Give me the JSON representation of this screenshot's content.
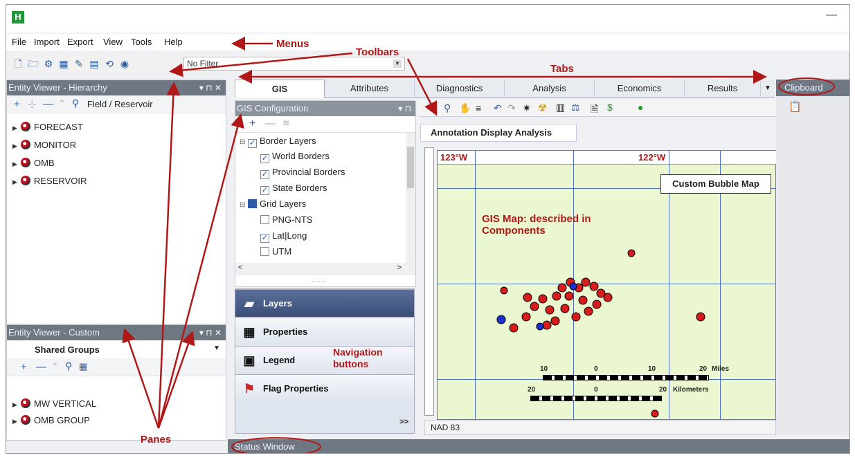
{
  "app": {
    "logo": "H",
    "minimize": "—"
  },
  "menus": [
    "File",
    "Import",
    "Export",
    "View",
    "Tools",
    "Help"
  ],
  "toolbar": {
    "filter_value": "No Filter"
  },
  "hierarchy": {
    "title": "Entity Viewer - Hierarchy",
    "pane_controls": "▾ ⊓ ✕",
    "toolbar_label": "Field / Reservoir",
    "items": [
      "FORECAST",
      "MONITOR",
      "OMB",
      "RESERVOIR"
    ]
  },
  "custom": {
    "title": "Entity Viewer - Custom",
    "pane_controls": "▾ ⊓ ✕",
    "dropdown": "Shared Groups",
    "items": [
      "MW VERTICAL",
      "OMB GROUP"
    ]
  },
  "tabs": [
    "GIS",
    "Attributes",
    "Diagnostics",
    "Analysis",
    "Economics",
    "Results"
  ],
  "gis_config": {
    "title": "GIS Configuration",
    "pane_controls": "▾ ⊓",
    "tree": [
      {
        "label": "Border Layers",
        "level": 0,
        "checked": true
      },
      {
        "label": "World Borders",
        "level": 1,
        "checked": true
      },
      {
        "label": "Provincial Borders",
        "level": 1,
        "checked": true
      },
      {
        "label": "State Borders",
        "level": 1,
        "checked": true
      },
      {
        "label": "Grid Layers",
        "level": 0,
        "checked": "partial"
      },
      {
        "label": "PNG-NTS",
        "level": 1,
        "checked": false
      },
      {
        "label": "Lat|Long",
        "level": 1,
        "checked": true
      },
      {
        "label": "UTM",
        "level": 1,
        "checked": false
      }
    ],
    "splitter": "........"
  },
  "nav_buttons": [
    "Layers",
    "Properties",
    "Legend",
    "Flag Properties"
  ],
  "nav_more": ">>",
  "map": {
    "subtab": "Annotation Display Analysis",
    "lon_left": "123°W",
    "lon_right": "122°W",
    "legend_box": "Custom Bubble Map",
    "description": "GIS Map: described in Components",
    "scale_miles": {
      "ticks": [
        "10",
        "0",
        "10",
        "20"
      ],
      "unit": "Miles"
    },
    "scale_km": {
      "ticks": [
        "20",
        "0",
        "20"
      ],
      "unit": "Kilometers"
    },
    "datum": "NAD 83"
  },
  "clipboard": {
    "title": "Clipboard"
  },
  "status": {
    "title": "Status Window"
  },
  "annotations": {
    "menus": "Menus",
    "toolbars": "Toolbars",
    "tabs": "Tabs",
    "panes": "Panes",
    "nav": "Navigation buttons"
  },
  "colors": {
    "accent_red": "#b01818",
    "pane_header": "#6f7882",
    "map_bg": "#eaf7d0"
  }
}
